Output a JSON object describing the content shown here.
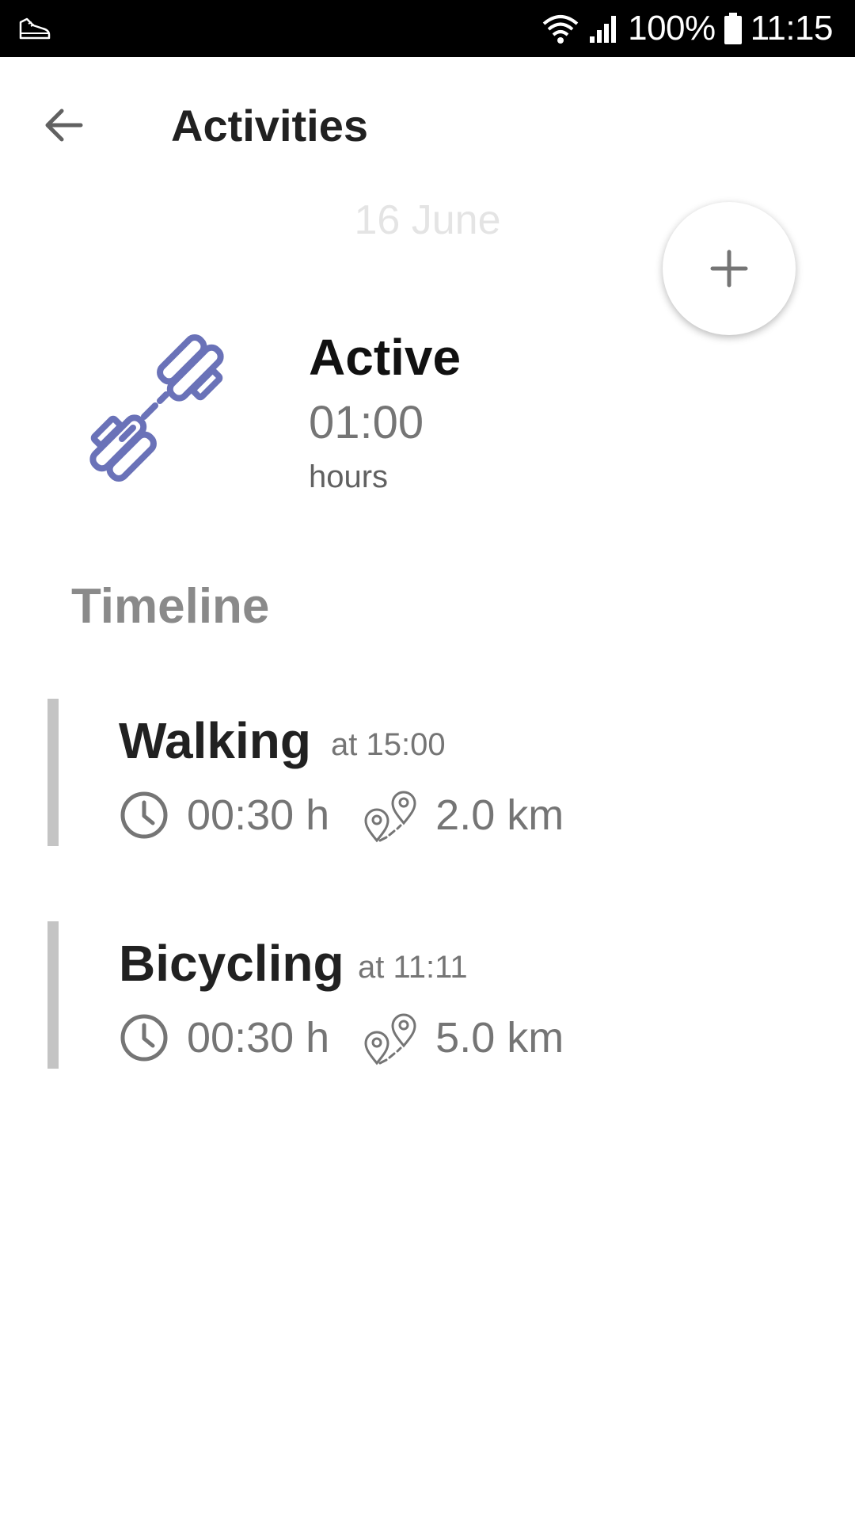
{
  "status_bar": {
    "battery": "100%",
    "time": "11:15",
    "icons": [
      "shoe-notification-icon",
      "wifi-icon",
      "signal-icon",
      "battery-icon"
    ]
  },
  "header": {
    "title": "Activities",
    "back_icon": "arrow-left-icon"
  },
  "date": "16 June",
  "fab": {
    "icon": "plus-icon"
  },
  "summary": {
    "icon": "dumbbell-icon",
    "label": "Active",
    "value": "01:00",
    "unit": "hours"
  },
  "timeline": {
    "title": "Timeline",
    "entries": [
      {
        "name": "Walking",
        "time": "at 15:00",
        "duration": "00:30 h",
        "distance": "2.0 km"
      },
      {
        "name": "Bicycling",
        "time": "at 11:11",
        "duration": "00:30 h",
        "distance": "5.0 km"
      }
    ]
  },
  "colors": {
    "accent": "#6a72b8",
    "timeline_bar": "#c4c4c4",
    "text_secondary": "#757575"
  }
}
